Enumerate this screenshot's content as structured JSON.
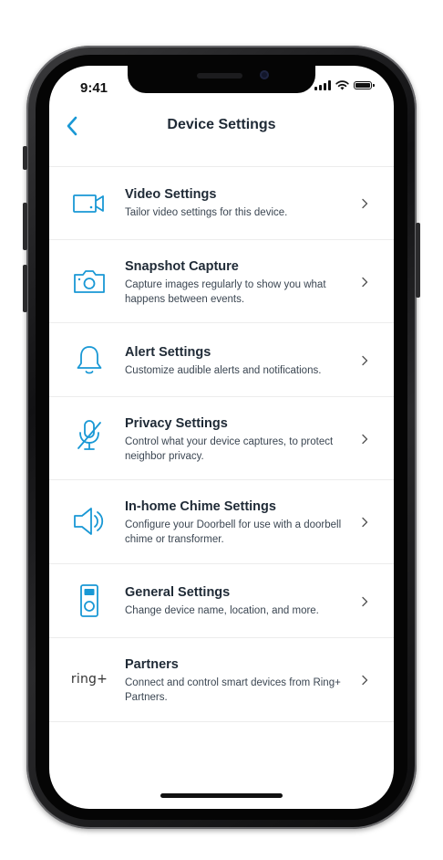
{
  "status_bar": {
    "time": "9:41"
  },
  "nav": {
    "title": "Device Settings",
    "back_icon": "chevron-left-icon"
  },
  "colors": {
    "accent": "#1998d5",
    "title_text": "#1f2a36",
    "body_text": "#3b4652",
    "divider": "#ececec"
  },
  "settings": [
    {
      "title": "Video Settings",
      "description": "Tailor video settings for this device.",
      "icon": "video-camera-icon"
    },
    {
      "title": "Snapshot Capture",
      "description": "Capture images regularly to show you what happens between events.",
      "icon": "camera-icon"
    },
    {
      "title": "Alert Settings",
      "description": "Customize audible alerts and notifications.",
      "icon": "bell-icon"
    },
    {
      "title": "Privacy Settings",
      "description": "Control what your device captures, to protect neighbor privacy.",
      "icon": "microphone-off-icon"
    },
    {
      "title": "In-home Chime Settings",
      "description": "Configure your Doorbell for use with a doorbell chime or transformer.",
      "icon": "speaker-icon"
    },
    {
      "title": "General Settings",
      "description": "Change device name, location, and more.",
      "icon": "doorbell-device-icon"
    },
    {
      "title": "Partners",
      "description": "Connect and control smart devices from Ring+ Partners.",
      "icon": "ring-plus-logo",
      "logo_text": "ring+"
    }
  ]
}
